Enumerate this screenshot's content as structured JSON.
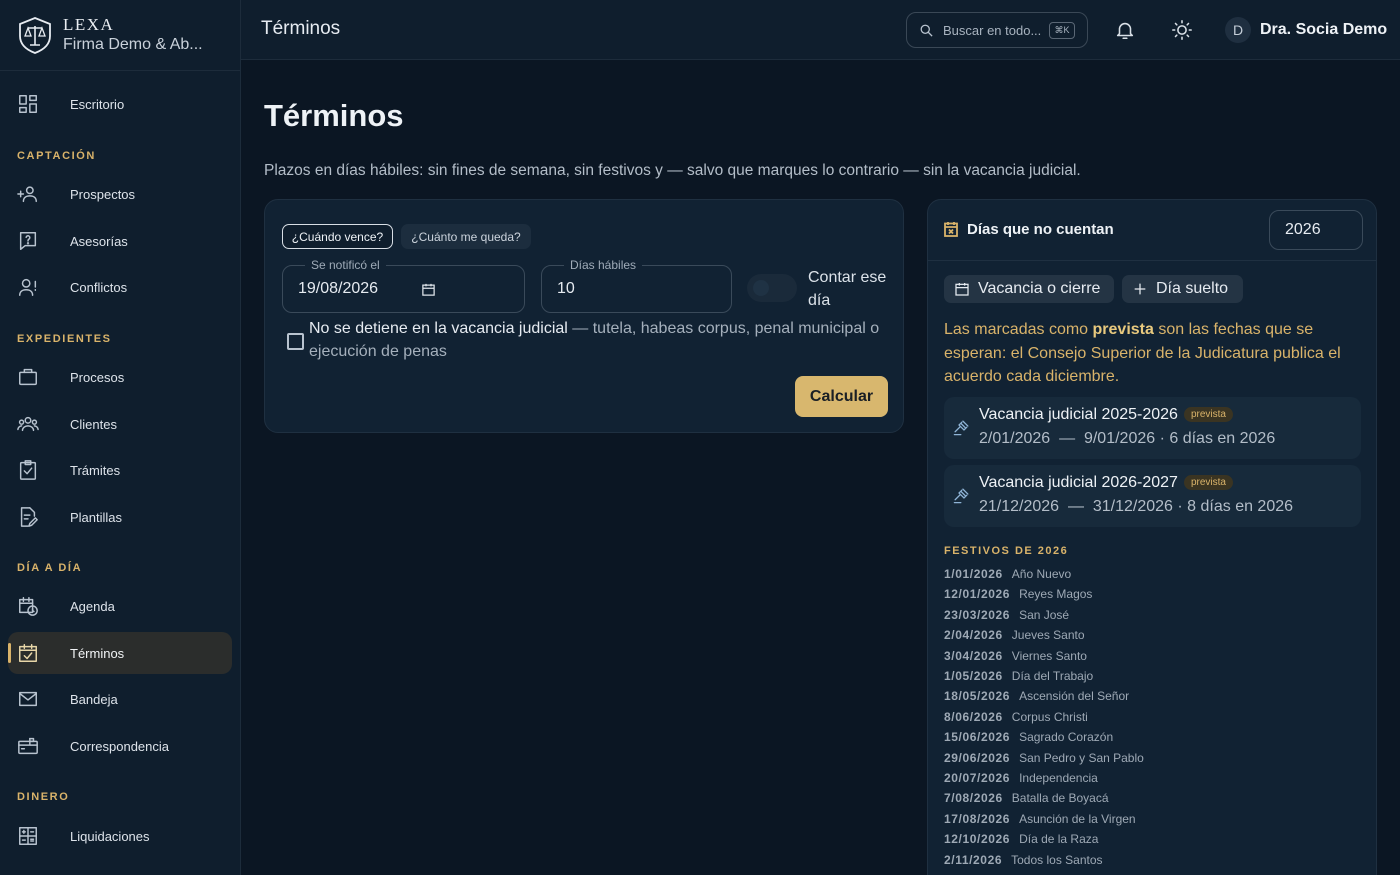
{
  "brand": {
    "name": "LEXA",
    "firm": "Firma Demo & Ab..."
  },
  "nav": {
    "top": [
      {
        "label": "Escritorio",
        "icon": "dashboard-icon"
      }
    ],
    "sections": [
      {
        "title": "CAPTACIÓN",
        "items": [
          {
            "label": "Prospectos",
            "icon": "user-plus-icon"
          },
          {
            "label": "Asesorías",
            "icon": "help-chat-icon"
          },
          {
            "label": "Conflictos",
            "icon": "user-alert-icon"
          }
        ]
      },
      {
        "title": "EXPEDIENTES",
        "items": [
          {
            "label": "Procesos",
            "icon": "briefcase-icon"
          },
          {
            "label": "Clientes",
            "icon": "users-icon"
          },
          {
            "label": "Trámites",
            "icon": "clipboard-check-icon"
          },
          {
            "label": "Plantillas",
            "icon": "file-edit-icon"
          }
        ]
      },
      {
        "title": "DÍA A DÍA",
        "items": [
          {
            "label": "Agenda",
            "icon": "calendar-clock-icon"
          },
          {
            "label": "Términos",
            "icon": "calendar-check-icon",
            "active": true
          },
          {
            "label": "Bandeja",
            "icon": "mail-icon"
          },
          {
            "label": "Correspondencia",
            "icon": "mailbox-icon"
          }
        ]
      },
      {
        "title": "DINERO",
        "items": [
          {
            "label": "Liquidaciones",
            "icon": "calculator-icon"
          }
        ]
      }
    ]
  },
  "topbar": {
    "title": "Términos",
    "search_placeholder": "Buscar en todo...",
    "search_shortcut": "⌘K",
    "user_initial": "D",
    "user_name": "Dra. Socia Demo"
  },
  "page": {
    "title": "Términos",
    "subtitle": "Plazos en días hábiles: sin fines de semana, sin festivos y  — salvo que marques lo contrario —  sin la vacancia judicial."
  },
  "calculator": {
    "tab_active": "¿Cuándo vence?",
    "tab_other": "¿Cuánto me queda?",
    "notified_label": "Se notificó el",
    "notified_value": "19/08/2026",
    "days_label": "Días hábiles",
    "days_value": "10",
    "count_day_label": "Contar ese día",
    "vacancy_text": "No se detiene en la vacancia judicial",
    "vacancy_separator": " — ",
    "vacancy_muted": "tutela, habeas corpus, penal municipal o ejecución de penas",
    "calc_button": "Calcular"
  },
  "holidays": {
    "title": "Días que no cuentan",
    "year": "2026",
    "add_vacancy": "Vacancia o cierre",
    "add_day": "Día suelto",
    "note_before": "Las marcadas como ",
    "note_bold": "prevista",
    "note_after": " son las fechas que se esperan: el Consejo Superior de la Judicatura publica el acuerdo cada diciembre.",
    "vacancies": [
      {
        "title": "Vacancia judicial 2025-2026",
        "badge": "prevista",
        "range": "2/01/2026  —  9/01/2026 · 6 días en 2026"
      },
      {
        "title": "Vacancia judicial 2026-2027",
        "badge": "prevista",
        "range": "21/12/2026  —  31/12/2026 · 8 días en 2026"
      }
    ],
    "festivos_title": "FESTIVOS DE 2026",
    "festivos": [
      {
        "date": "1/01/2026",
        "name": "Año Nuevo"
      },
      {
        "date": "12/01/2026",
        "name": "Reyes Magos"
      },
      {
        "date": "23/03/2026",
        "name": "San José"
      },
      {
        "date": "2/04/2026",
        "name": "Jueves Santo"
      },
      {
        "date": "3/04/2026",
        "name": "Viernes Santo"
      },
      {
        "date": "1/05/2026",
        "name": "Día del Trabajo"
      },
      {
        "date": "18/05/2026",
        "name": "Ascensión del Señor"
      },
      {
        "date": "8/06/2026",
        "name": "Corpus Christi"
      },
      {
        "date": "15/06/2026",
        "name": "Sagrado Corazón"
      },
      {
        "date": "29/06/2026",
        "name": "San Pedro y San Pablo"
      },
      {
        "date": "20/07/2026",
        "name": "Independencia"
      },
      {
        "date": "7/08/2026",
        "name": "Batalla de Boyacá"
      },
      {
        "date": "17/08/2026",
        "name": "Asunción de la Virgen"
      },
      {
        "date": "12/10/2026",
        "name": "Día de la Raza"
      },
      {
        "date": "2/11/2026",
        "name": "Todos los Santos"
      }
    ]
  },
  "colors": {
    "accent": "#d9b36a",
    "background": "#0b1623",
    "panel": "#112233"
  }
}
